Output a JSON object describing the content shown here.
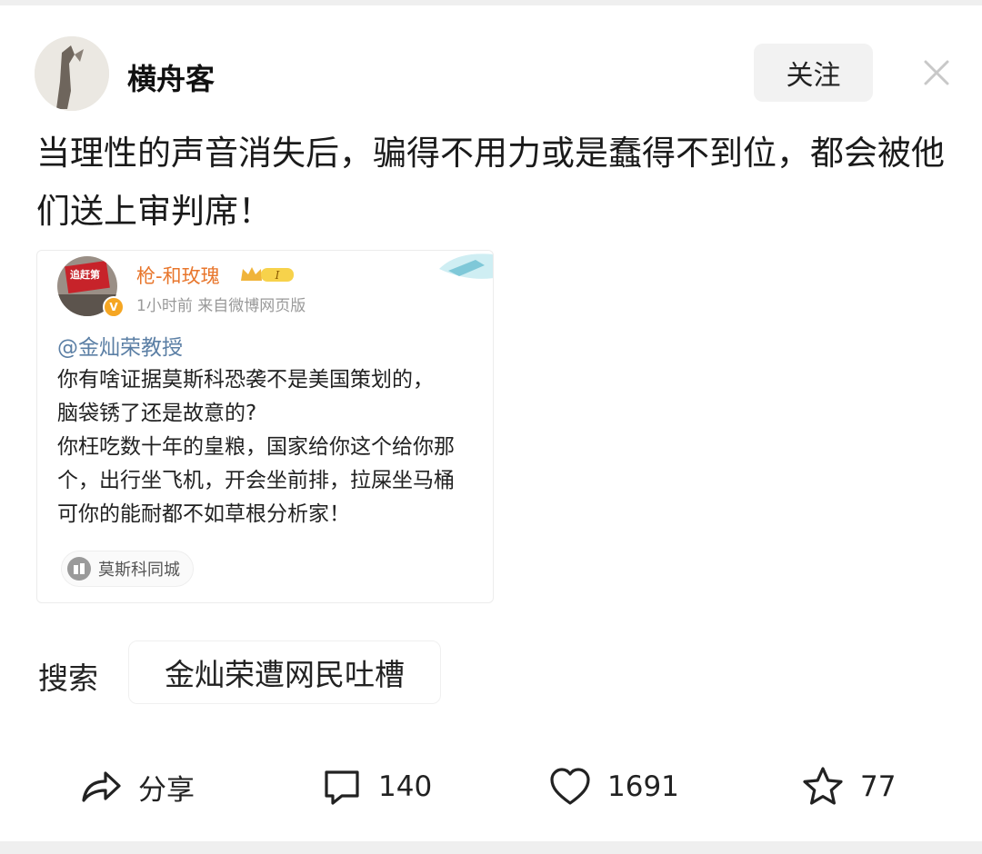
{
  "post": {
    "username": "横舟客",
    "follow_label": "关注",
    "text": "当理性的声音消失后，骗得不用力或是蠢得不到位，都会被他们送上审判席！"
  },
  "quoted_card": {
    "avatar_flag_text": "追赶第",
    "username": "枪-和玫瑰",
    "level_badge": "I",
    "meta": "1小时前  来自微博网页版",
    "mention": "@金灿荣教授",
    "body": "你有啥证据莫斯科恐袭不是美国策划的，\n脑袋锈了还是故意的?\n你枉吃数十年的皇粮，国家给你这个给你那\n个，出行坐飞机，开会坐前排，拉屎坐马桶\n可你的能耐都不如草根分析家！",
    "topic": "莫斯科同城"
  },
  "search": {
    "label": "搜索",
    "query": "金灿荣遭网民吐槽"
  },
  "actions": {
    "share_label": "分享",
    "comment_count": "140",
    "like_count": "1691",
    "fav_count": "77"
  },
  "icons": [
    "close-icon",
    "share-icon",
    "comment-icon",
    "like-icon",
    "favorite-icon",
    "verified-icon",
    "crown-icon",
    "location-icon"
  ],
  "colors": {
    "card_name": "#e8762c",
    "mention": "#5b7fa5",
    "verified": "#f5a623"
  }
}
